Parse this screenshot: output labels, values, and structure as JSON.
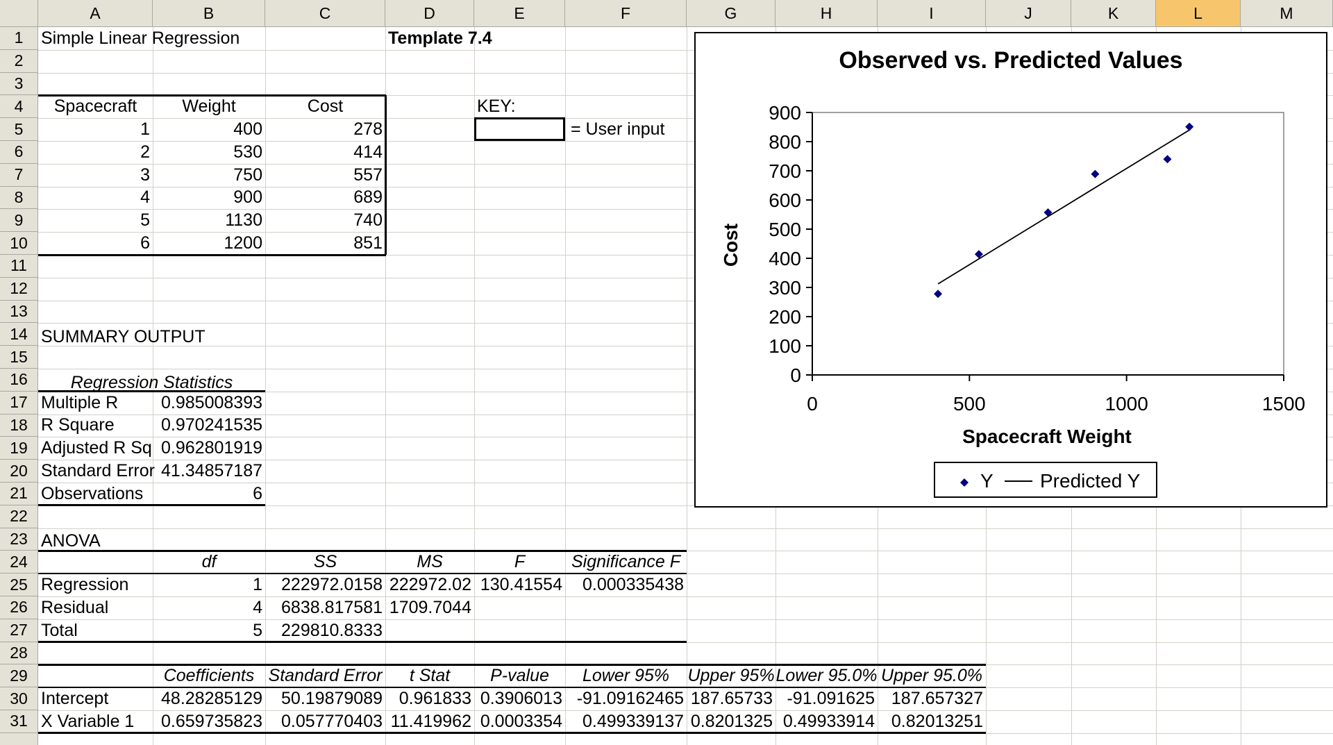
{
  "columns": [
    "A",
    "B",
    "C",
    "D",
    "E",
    "F",
    "G",
    "H",
    "I",
    "J",
    "K",
    "L",
    "M"
  ],
  "selected_column": "L",
  "rows": [
    "1",
    "2",
    "3",
    "4",
    "5",
    "6",
    "7",
    "8",
    "9",
    "10",
    "11",
    "12",
    "13",
    "14",
    "15",
    "16",
    "17",
    "18",
    "19",
    "20",
    "21",
    "22",
    "23",
    "24",
    "25",
    "26",
    "27",
    "28",
    "29",
    "30",
    "31"
  ],
  "header": {
    "title": "Simple Linear Regression",
    "template": "Template 7.4"
  },
  "key": {
    "label": "KEY:",
    "text": "= User input"
  },
  "input_table": {
    "headers": [
      "Spacecraft",
      "Weight",
      "Cost"
    ],
    "rows": [
      [
        "1",
        "400",
        "278"
      ],
      [
        "2",
        "530",
        "414"
      ],
      [
        "3",
        "750",
        "557"
      ],
      [
        "4",
        "900",
        "689"
      ],
      [
        "5",
        "1130",
        "740"
      ],
      [
        "6",
        "1200",
        "851"
      ]
    ]
  },
  "summary": {
    "title": "SUMMARY OUTPUT",
    "regression_stats_title": "Regression Statistics",
    "stats": [
      [
        "Multiple R",
        "0.985008393"
      ],
      [
        "R Square",
        "0.970241535"
      ],
      [
        "Adjusted R Sq",
        "0.962801919"
      ],
      [
        "Standard Error",
        "41.34857187"
      ],
      [
        "Observations",
        "6"
      ]
    ]
  },
  "anova": {
    "title": "ANOVA",
    "headers": [
      "df",
      "SS",
      "MS",
      "F",
      "Significance F"
    ],
    "rows": [
      [
        "Regression",
        "1",
        "222972.0158",
        "222972.02",
        "130.41554",
        "0.000335438"
      ],
      [
        "Residual",
        "4",
        "6838.817581",
        "1709.7044",
        "",
        ""
      ],
      [
        "Total",
        "5",
        "229810.8333",
        "",
        "",
        ""
      ]
    ]
  },
  "coefficients": {
    "headers": [
      "Coefficients",
      "Standard Error",
      "t Stat",
      "P-value",
      "Lower 95%",
      "Upper 95%",
      "Lower 95.0%",
      "Upper 95.0%"
    ],
    "rows": [
      [
        "Intercept",
        "48.28285129",
        "50.19879089",
        "0.961833",
        "0.3906013",
        "-91.09162465",
        "187.65733",
        "-91.091625",
        "187.657327"
      ],
      [
        "X Variable 1",
        "0.659735823",
        "0.057770403",
        "11.419962",
        "0.0003354",
        "0.499339137",
        "0.8201325",
        "0.49933914",
        "0.82013251"
      ]
    ]
  },
  "chart_data": {
    "type": "scatter",
    "title": "Observed vs. Predicted Values",
    "xlabel": "Spacecraft Weight",
    "ylabel": "Cost",
    "xlim": [
      0,
      1500
    ],
    "ylim": [
      0,
      900
    ],
    "x_ticks": [
      "0",
      "500",
      "1000",
      "1500"
    ],
    "y_ticks": [
      "0",
      "100",
      "200",
      "300",
      "400",
      "500",
      "600",
      "700",
      "800",
      "900"
    ],
    "legend_position": "bottom",
    "grid": false,
    "series": [
      {
        "name": "Y",
        "kind": "markers",
        "marker": "diamond",
        "color": "#000080",
        "x": [
          400,
          530,
          750,
          900,
          1130,
          1200
        ],
        "y": [
          278,
          414,
          557,
          689,
          740,
          851
        ]
      },
      {
        "name": "Predicted Y",
        "kind": "line",
        "color": "#000000",
        "x": [
          400,
          530,
          750,
          900,
          1130,
          1200
        ],
        "y": [
          312.18,
          397.95,
          543.09,
          642.05,
          793.79,
          839.97
        ]
      }
    ]
  }
}
